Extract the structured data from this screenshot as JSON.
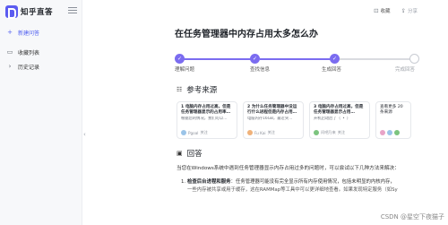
{
  "app": {
    "logo_text": "知乎直答"
  },
  "sidebar": {
    "items": [
      {
        "label": "新建问答",
        "icon": "plus-icon"
      },
      {
        "label": "收藏列表",
        "icon": "bookmark-icon"
      },
      {
        "label": "历史记录",
        "icon": "history-icon"
      }
    ]
  },
  "top_actions": {
    "bookmark_label": "收藏",
    "share_label": "分享"
  },
  "page": {
    "title": "在任务管理器中内存占用太多怎么办"
  },
  "steps": [
    {
      "label": "理解问题",
      "done": true
    },
    {
      "label": "查找信息",
      "done": true
    },
    {
      "label": "生成回答",
      "done": true
    },
    {
      "label": "完成回答",
      "done": false
    }
  ],
  "sources": {
    "title": "参考来源",
    "cards": [
      {
        "index": "1",
        "title": "电脑内存占用过高，但是任务管理器显示的占用率…",
        "snippet": "根据您的情况，我们可以…",
        "author": "Pgoal",
        "badge": "关注"
      },
      {
        "index": "2",
        "title": "为什么任务管理器中没运行什么进程但是内存占用…",
        "snippet": "电脑内存16GB，最近突…",
        "author": "Fu Kai",
        "badge": "关注"
      },
      {
        "index": "3",
        "title": "电脑内存占用过高，但是任务管理器显示占用…",
        "snippet": "开机启动后了（˘•˘）",
        "author": "问吧乃来",
        "badge": "关注"
      },
      {
        "index": "",
        "title": "查看更多 20 条来源",
        "snippet": "",
        "author": "",
        "badge": ""
      }
    ]
  },
  "answer": {
    "title": "回答",
    "intro": "当您在Windows系统中遇到任务管理器显示内存占用过多的问题时，可以尝试以下几种方法来解决：",
    "items": [
      {
        "num": "1.",
        "heading": "检查后台进程和服务",
        "line1": "：任务管理器可能没有完全显示所有内存使用情况，包括未明显的内核内存，",
        "line2": "一些内存被共享或用于缓存，这在RAMMap等工具中可以更详细地查看。如果发现特定服务（如Sy"
      }
    ]
  },
  "watermark": "CSDN @星空下夜猫子",
  "colors": {
    "accent": "#5b5bf0",
    "step_done": "#7b6cf0",
    "sidebar_bg": "#f7f8fa"
  }
}
